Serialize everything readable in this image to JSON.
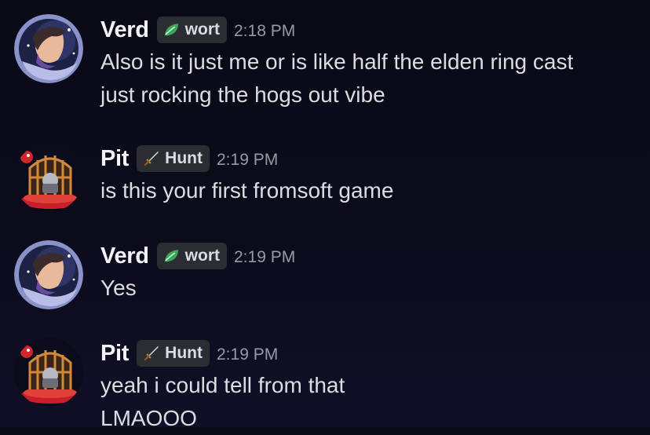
{
  "messages": [
    {
      "username": "Verd",
      "tag": "wort",
      "tag_icon": "leaf-icon",
      "timestamp": "2:18 PM",
      "lines": [
        "Also is it just me or is like half the elden ring cast",
        "just rocking the hogs out vibe"
      ]
    },
    {
      "username": "Pit",
      "tag": "Hunt",
      "tag_icon": "sword-icon",
      "timestamp": "2:19 PM",
      "lines": [
        "is this your first fromsoft game"
      ]
    },
    {
      "username": "Verd",
      "tag": "wort",
      "tag_icon": "leaf-icon",
      "timestamp": "2:19 PM",
      "lines": [
        "Yes"
      ]
    },
    {
      "username": "Pit",
      "tag": "Hunt",
      "tag_icon": "sword-icon",
      "timestamp": "2:19 PM",
      "lines": [
        "yeah i could tell from that",
        "LMAOOO"
      ]
    }
  ],
  "colors": {
    "background": "#0c0b1c",
    "username": "#f2f3f5",
    "message_text": "#dbdee1",
    "timestamp": "#949ba4",
    "tag_background": "#2b2d31",
    "leaf_green": "#3ba55c"
  }
}
